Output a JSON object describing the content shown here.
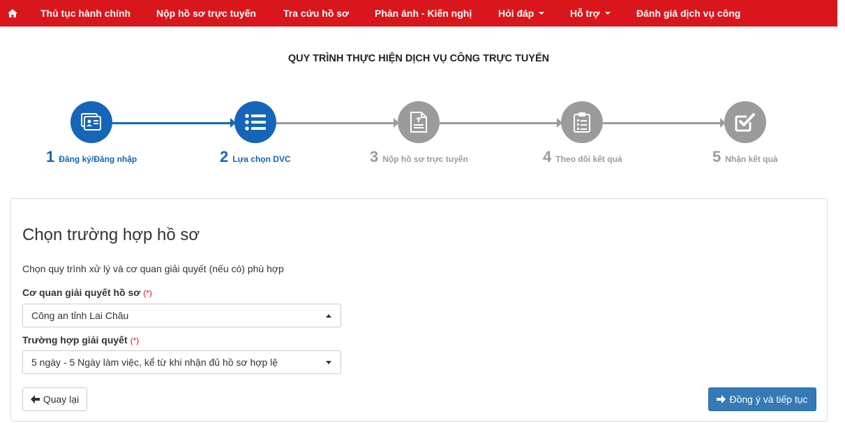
{
  "nav": {
    "home_icon": "home-icon",
    "items": [
      {
        "label": "Thủ tục hành chính"
      },
      {
        "label": "Nộp hồ sơ trực tuyến"
      },
      {
        "label": "Tra cứu hồ sơ"
      },
      {
        "label": "Phản ánh - Kiến nghị"
      },
      {
        "label": "Hỏi đáp"
      },
      {
        "label": "Hỗ trợ"
      },
      {
        "label": "Đánh giá dịch vụ công"
      }
    ]
  },
  "process": {
    "title": "QUY TRÌNH THỰC HIỆN DỊCH VỤ CÔNG TRỰC TUYẾN",
    "steps": [
      {
        "num": "1",
        "label": "Đăng ký/Đăng nhập",
        "icon": "id-card-icon",
        "state": "active"
      },
      {
        "num": "2",
        "label": "Lựa chọn DVC",
        "icon": "list-icon",
        "state": "active"
      },
      {
        "num": "3",
        "label": "Nộp hồ sơ trực tuyến",
        "icon": "file-upload-icon",
        "state": "inactive"
      },
      {
        "num": "4",
        "label": "Theo dõi kết quả",
        "icon": "clipboard-icon",
        "state": "inactive"
      },
      {
        "num": "5",
        "label": "Nhận kết quả",
        "icon": "check-square-icon",
        "state": "inactive"
      }
    ]
  },
  "form": {
    "heading": "Chọn trường hợp hồ sơ",
    "description": "Chọn quy trình xử lý và cơ quan giải quyết (nếu có) phù hợp",
    "agency_label": "Cơ quan giải quyết hồ sơ",
    "agency_required": "(*)",
    "agency_value": "Công an tỉnh Lai Châu",
    "case_label": "Trường hợp giải quyết",
    "case_required": "(*)",
    "case_value": "5 ngày - 5 Ngày làm việc, kể từ khi nhận đủ hồ sơ hợp lệ",
    "back_label": "Quay lại",
    "next_label": "Đồng ý và tiếp tục"
  },
  "colors": {
    "nav_bg": "#d9161c",
    "active": "#1565b8",
    "inactive": "#9b9b9b",
    "primary_button": "#337ab7"
  }
}
